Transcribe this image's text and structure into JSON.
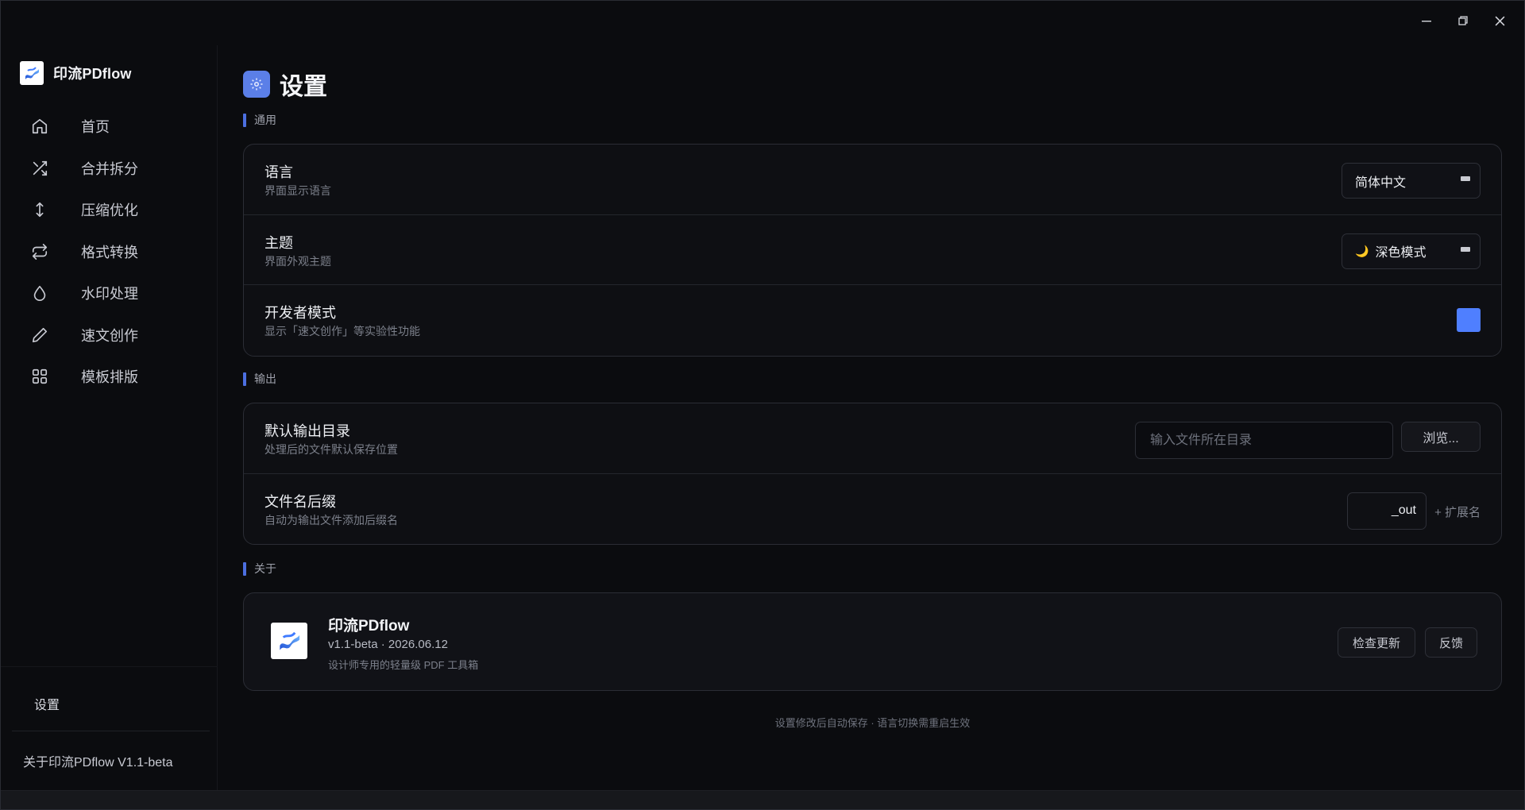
{
  "window": {
    "controls": [
      "minimize-icon",
      "restore-icon",
      "close-icon"
    ]
  },
  "brand": {
    "name": "印流PDflow",
    "logo_icon": "flow-logo-icon"
  },
  "sidebar": {
    "items": [
      {
        "label": "首页",
        "icon": "home-icon"
      },
      {
        "label": "合并拆分",
        "icon": "shuffle-icon"
      },
      {
        "label": "压缩优化",
        "icon": "compress-arrows-icon"
      },
      {
        "label": "格式转换",
        "icon": "convert-icon"
      },
      {
        "label": "水印处理",
        "icon": "droplet-icon"
      },
      {
        "label": "速文创作",
        "icon": "pen-icon"
      },
      {
        "label": "模板排版",
        "icon": "grid-icon"
      }
    ],
    "settings_label": "设置",
    "about_label": "关于印流PDflow  V1.1-beta"
  },
  "page": {
    "title": "设置",
    "title_icon": "gear-icon"
  },
  "sections": {
    "general": {
      "heading": "通用",
      "language": {
        "title": "语言",
        "desc": "界面显示语言",
        "value": "简体中文"
      },
      "theme": {
        "title": "主题",
        "desc": "界面外观主题",
        "value": "深色模式",
        "icon": "moon-icon"
      },
      "dev_mode": {
        "title": "开发者模式",
        "desc": "显示「速文创作」等实验性功能",
        "enabled": true
      }
    },
    "output": {
      "heading": "输出",
      "dir": {
        "title": "默认输出目录",
        "desc": "处理后的文件默认保存位置",
        "placeholder": "输入文件所在目录",
        "value": "",
        "browse_label": "浏览..."
      },
      "suffix": {
        "title": "文件名后缀",
        "desc": "自动为输出文件添加后缀名",
        "value": "_out",
        "hint": "+ 扩展名"
      }
    },
    "about": {
      "heading": "关于",
      "name": "印流PDflow",
      "version": "v1.1-beta · 2026.06.12",
      "desc": "设计师专用的轻量级 PDF 工具箱",
      "check_update_label": "检查更新",
      "feedback_label": "反馈"
    }
  },
  "footnote": "设置修改后自动保存 · 语言切换需重启生效",
  "colors": {
    "accent": "#4f7fff",
    "section_bar": "#4c6fe0",
    "title_badge": "#5b7fe8"
  }
}
